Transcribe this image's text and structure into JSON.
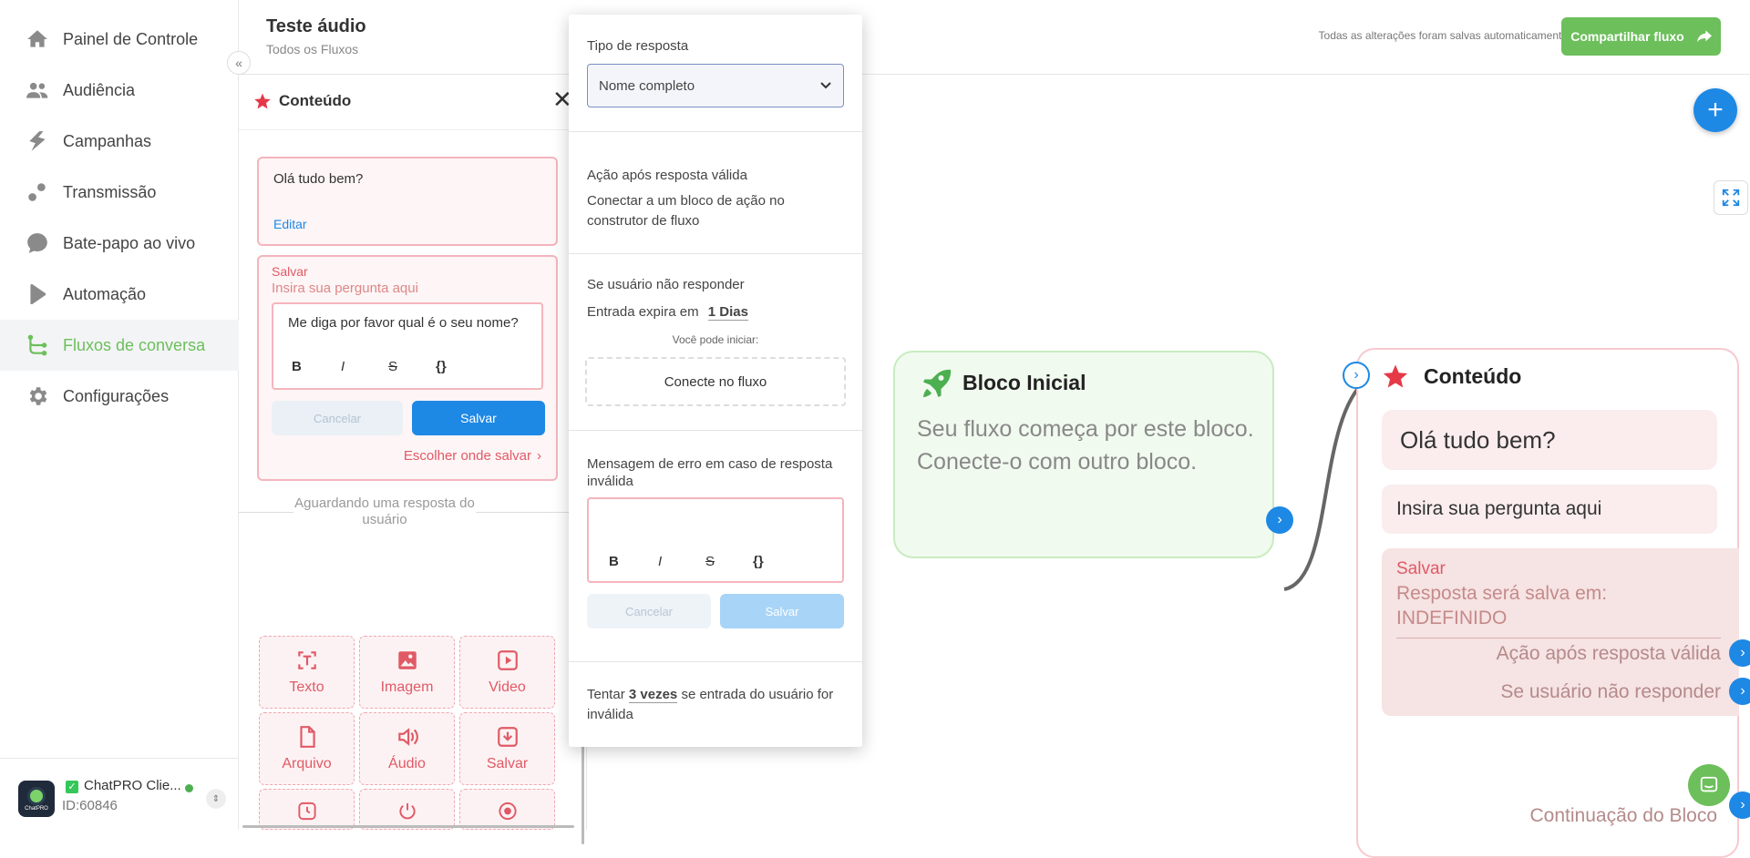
{
  "sidebar": {
    "items": [
      {
        "label": "Painel de Controle",
        "icon": "home-icon"
      },
      {
        "label": "Audiência",
        "icon": "users-icon"
      },
      {
        "label": "Campanhas",
        "icon": "campaign-icon"
      },
      {
        "label": "Transmissão",
        "icon": "broadcast-icon"
      },
      {
        "label": "Bate-papo ao vivo",
        "icon": "chat-bubble-icon"
      },
      {
        "label": "Automação",
        "icon": "play-icon"
      },
      {
        "label": "Fluxos de conversa",
        "icon": "flow-icon"
      },
      {
        "label": "Configurações",
        "icon": "gear-icon"
      }
    ],
    "active": "Fluxos de conversa",
    "account": {
      "name": "ChatPRO Clie...",
      "id": "ID:60846",
      "logo_text": "ChatPRO"
    }
  },
  "header": {
    "title": "Teste áudio",
    "breadcrumb": "Todos os Fluxos",
    "autosave": "Todas as alterações foram salvas automaticamente",
    "share_label": "Compartilhar fluxo"
  },
  "panel": {
    "title": "Conteúdo",
    "message_text": "Olá tudo bem?",
    "edit_label": "Editar",
    "save_section_label": "Salvar",
    "question_placeholder": "Insira sua pergunta aqui",
    "question_value": "Me diga por favor qual é o seu nome?",
    "cancel_label": "Cancelar",
    "save_label": "Salvar",
    "choose_where_label": "Escolher onde salvar",
    "waiting_label": "Aguardando uma resposta do usuário",
    "format_buttons": [
      "B",
      "I",
      "S",
      "{}"
    ],
    "tiles": [
      {
        "label": "Texto",
        "icon": "text-icon"
      },
      {
        "label": "Imagem",
        "icon": "image-icon"
      },
      {
        "label": "Video",
        "icon": "video-icon"
      },
      {
        "label": "Arquivo",
        "icon": "file-icon"
      },
      {
        "label": "Áudio",
        "icon": "audio-icon"
      },
      {
        "label": "Salvar",
        "icon": "download-icon"
      }
    ]
  },
  "popover": {
    "response_type_label": "Tipo de resposta",
    "response_type_value": "Nome completo",
    "valid_action_title": "Ação após resposta válida",
    "valid_action_desc": "Conectar a um bloco de ação no construtor de fluxo",
    "no_reply_title": "Se usuário não responder",
    "expires_prefix": "Entrada expira em",
    "expires_value": "1 Dias",
    "can_start": "Você pode iniciar:",
    "connect_label": "Conecte no fluxo",
    "error_msg_title": "Mensagem de erro em caso de resposta inválida",
    "cancel_label": "Cancelar",
    "save_label": "Salvar",
    "retry_prefix": "Tentar",
    "retry_value": "3 vezes",
    "retry_suffix": "se entrada do usuário for inválida"
  },
  "canvas": {
    "start_block": {
      "title": "Bloco Inicial",
      "desc": "Seu fluxo começa por este bloco. Conecte-o com outro bloco."
    },
    "content_block": {
      "title": "Conteúdo",
      "message": "Olá tudo bem?",
      "question": "Insira sua pergunta aqui",
      "save_label": "Salvar",
      "save_target": "Resposta será salva em: INDEFINIDO",
      "valid_action": "Ação após resposta válida",
      "no_reply": "Se usuário não responder",
      "continuation": "Continuação do Bloco"
    }
  },
  "colors": {
    "accent_green": "#6cbf5b",
    "primary_blue": "#1e88e5",
    "danger_red": "#e05a66"
  }
}
